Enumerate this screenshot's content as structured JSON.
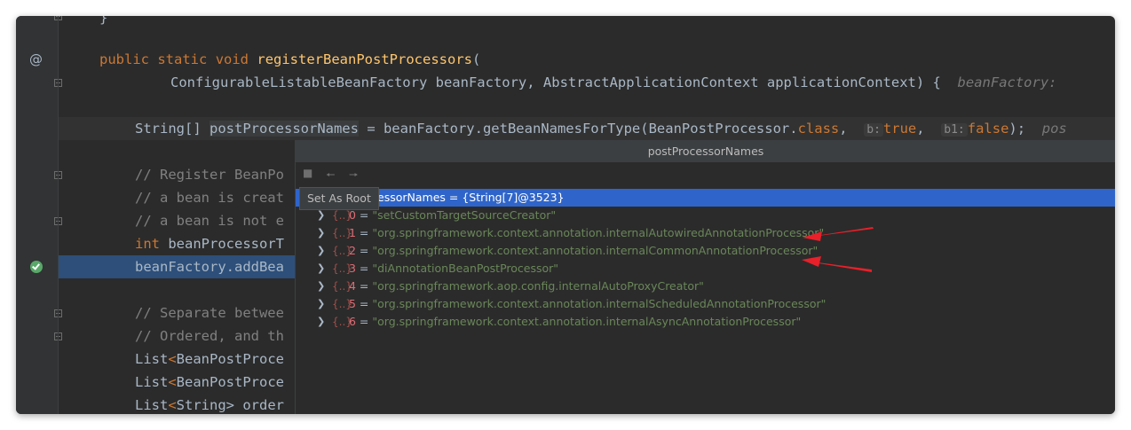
{
  "editor": {
    "lines": {
      "l0": "}",
      "l1_kw1": "public",
      "l1_kw2": "static",
      "l1_kw3": "void",
      "l1_fn": "registerBeanPostProcessors",
      "l1_paren": "(",
      "l2_code": "ConfigurableListableBeanFactory beanFactory, AbstractApplicationContext applicationContext) {",
      "l2_hint": "beanFactory: ",
      "l3_a": "String[] ",
      "l3_var": "postProcessorNames",
      "l3_b": " = beanFactory.getBeanNamesForType(BeanPostProcessor.",
      "l3_class": "class",
      "l3_c": ", ",
      "l3_inlay_b": "b:",
      "l3_true": "true",
      "l3_d": ", ",
      "l3_inlay_b1": "b1:",
      "l3_false": "false",
      "l3_e": ");",
      "l3_hint": "pos",
      "l4": "// Register BeanPo",
      "l5": "// a bean is creat",
      "l6": "// a bean is not e",
      "l7_kw": "int",
      "l7_rest": " beanProcessorT",
      "l8": "beanFactory.addBea",
      "l9": "// Separate betwee",
      "l10": "// Ordered, and th",
      "l11_a": "List",
      "l11_b": "BeanPostProce",
      "l12_a": "List",
      "l12_b": "BeanPostProce",
      "l13_a": "List",
      "l13_b": "String",
      "l13_c": "> order"
    },
    "gutter": {
      "at_icon": "@"
    }
  },
  "popup": {
    "title": "postProcessorNames",
    "tooltip": "Set As Root",
    "root_label": "essorNames = {String[7]@3523}",
    "items": [
      {
        "index": "0",
        "value": "\"setCustomTargetSourceCreator\""
      },
      {
        "index": "1",
        "value": "\"org.springframework.context.annotation.internalAutowiredAnnotationProcessor\""
      },
      {
        "index": "2",
        "value": "\"org.springframework.context.annotation.internalCommonAnnotationProcessor\""
      },
      {
        "index": "3",
        "value": "\"diAnnotationBeanPostProcessor\""
      },
      {
        "index": "4",
        "value": "\"org.springframework.aop.config.internalAutoProxyCreator\""
      },
      {
        "index": "5",
        "value": "\"org.springframework.context.annotation.internalScheduledAnnotationProcessor\""
      },
      {
        "index": "6",
        "value": "\"org.springframework.context.annotation.internalAsyncAnnotationProcessor\""
      }
    ]
  },
  "colors": {
    "editor_bg": "#2b2b2b",
    "keyword": "#cc7832",
    "function": "#ffc66d",
    "string": "#6a8759",
    "selection": "#2f65ca",
    "annotation_arrow": "#e8202a"
  }
}
